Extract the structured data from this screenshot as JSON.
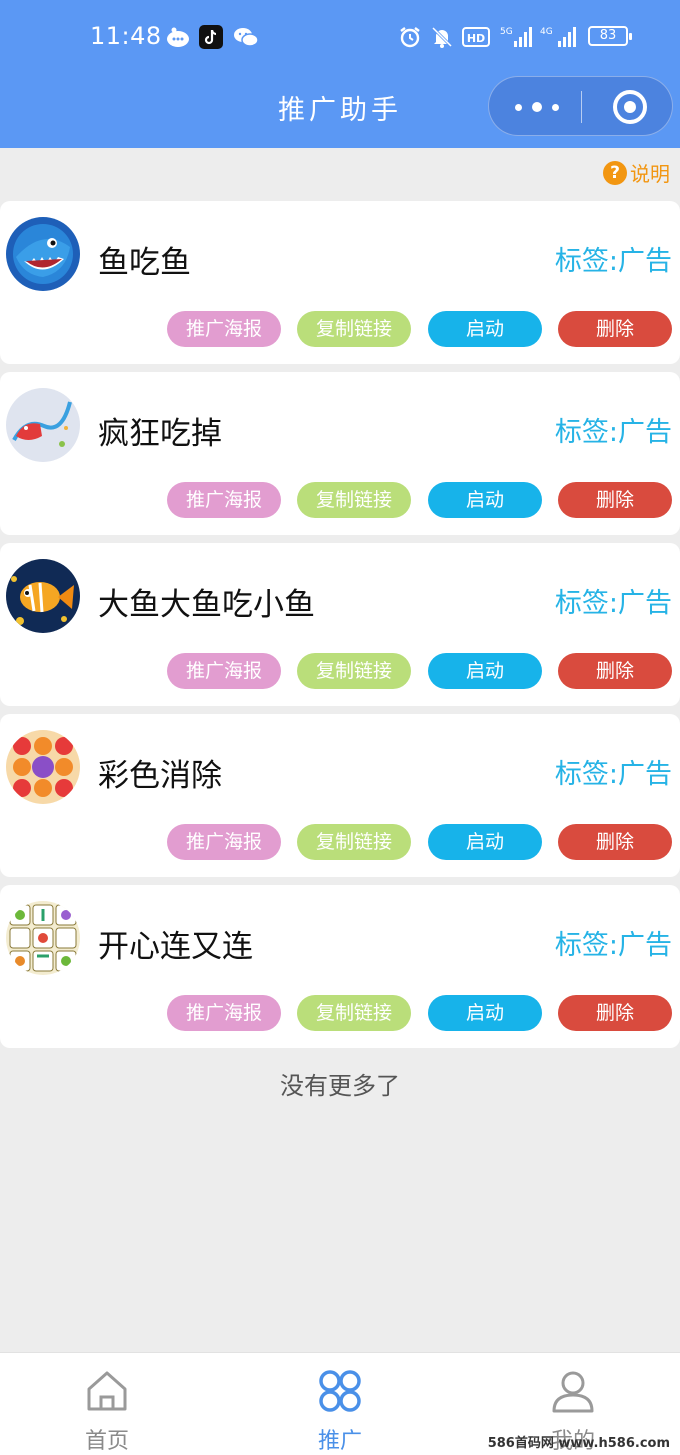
{
  "status_bar": {
    "time": "11:48",
    "icons": [
      "bubble-icon",
      "tiktok-icon",
      "wechat-icon",
      "alarm-icon",
      "mute-icon",
      "hd-icon",
      "signal-5g-icon",
      "signal-4g-icon"
    ],
    "battery": "83"
  },
  "header": {
    "title": "推广助手",
    "capsule_icons": [
      "more-icon",
      "close-mini-program-icon"
    ]
  },
  "help": {
    "icon": "?",
    "label": "说明"
  },
  "games": [
    {
      "name": "鱼吃鱼",
      "tag": "标签:广告",
      "avatar": "shark-fish-icon"
    },
    {
      "name": "疯狂吃掉",
      "tag": "标签:广告",
      "avatar": "snake-game-icon"
    },
    {
      "name": "大鱼大鱼吃小鱼",
      "tag": "标签:广告",
      "avatar": "goldfish-icon"
    },
    {
      "name": "彩色消除",
      "tag": "标签:广告",
      "avatar": "fruit-match-icon"
    },
    {
      "name": "开心连又连",
      "tag": "标签:广告",
      "avatar": "link-tiles-icon"
    }
  ],
  "actions": {
    "poster": "推广海报",
    "copy": "复制链接",
    "start": "启动",
    "delete": "删除"
  },
  "colors": {
    "header": "#5b98f4",
    "tag": "#26b3e6",
    "poster": "#e29dd0",
    "copy": "#bade7a",
    "start": "#17b3ea",
    "delete": "#d94b3e",
    "help": "#f29611"
  },
  "list_footer": "没有更多了",
  "tabbar": {
    "items": [
      {
        "label": "首页",
        "icon": "home-icon"
      },
      {
        "label": "推广",
        "icon": "grid-icon"
      },
      {
        "label": "我的",
        "icon": "user-icon"
      }
    ]
  },
  "watermark": "586首码网 www.h586.com"
}
